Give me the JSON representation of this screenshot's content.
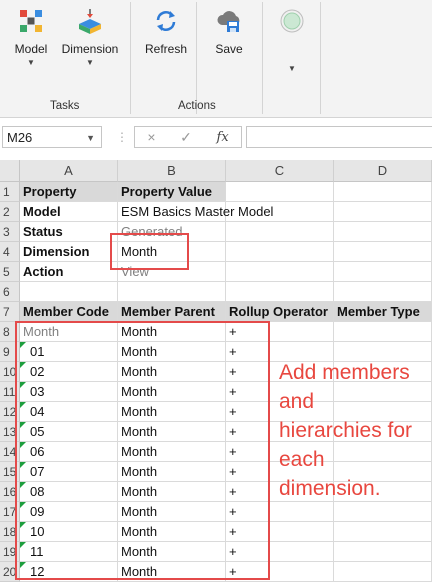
{
  "ribbon": {
    "buttons": {
      "model": "Model",
      "dimension": "Dimension",
      "refresh": "Refresh",
      "save": "Save"
    },
    "groups": {
      "tasks": "Tasks",
      "actions": "Actions"
    }
  },
  "formula_bar": {
    "name_box": "M26",
    "cancel": "×",
    "enter": "✓",
    "fx": "fx"
  },
  "columns": [
    "A",
    "B",
    "C",
    "D"
  ],
  "rows": [
    "1",
    "2",
    "3",
    "4",
    "5",
    "6",
    "7",
    "8",
    "9",
    "10",
    "11",
    "12",
    "13",
    "14",
    "15",
    "16",
    "17",
    "18",
    "19",
    "20"
  ],
  "properties": [
    {
      "a": "Property",
      "b": "Property Value"
    },
    {
      "a": "Model",
      "b": "ESM Basics Master Model"
    },
    {
      "a": "Status",
      "b": "Generated"
    },
    {
      "a": "Dimension",
      "b": "Month"
    },
    {
      "a": "Action",
      "b": "View"
    }
  ],
  "member_headers": [
    "Member Code",
    "Member Parent",
    "Rollup Operator",
    "Member Type"
  ],
  "members": [
    {
      "code": "Month",
      "parent": "Month",
      "op": "+"
    },
    {
      "code": "01",
      "parent": "Month",
      "op": "+"
    },
    {
      "code": "02",
      "parent": "Month",
      "op": "+"
    },
    {
      "code": "03",
      "parent": "Month",
      "op": "+"
    },
    {
      "code": "04",
      "parent": "Month",
      "op": "+"
    },
    {
      "code": "05",
      "parent": "Month",
      "op": "+"
    },
    {
      "code": "06",
      "parent": "Month",
      "op": "+"
    },
    {
      "code": "07",
      "parent": "Month",
      "op": "+"
    },
    {
      "code": "08",
      "parent": "Month",
      "op": "+"
    },
    {
      "code": "09",
      "parent": "Month",
      "op": "+"
    },
    {
      "code": "10",
      "parent": "Month",
      "op": "+"
    },
    {
      "code": "11",
      "parent": "Month",
      "op": "+"
    },
    {
      "code": "12",
      "parent": "Month",
      "op": "+"
    }
  ],
  "annotation": "Add members and hierarchies for each dimension.",
  "colors": {
    "highlight": "#e44a4a",
    "annotation": "#e8473f",
    "comment_marker": "#1e9e3e",
    "header_band": "#d9d9d9"
  }
}
